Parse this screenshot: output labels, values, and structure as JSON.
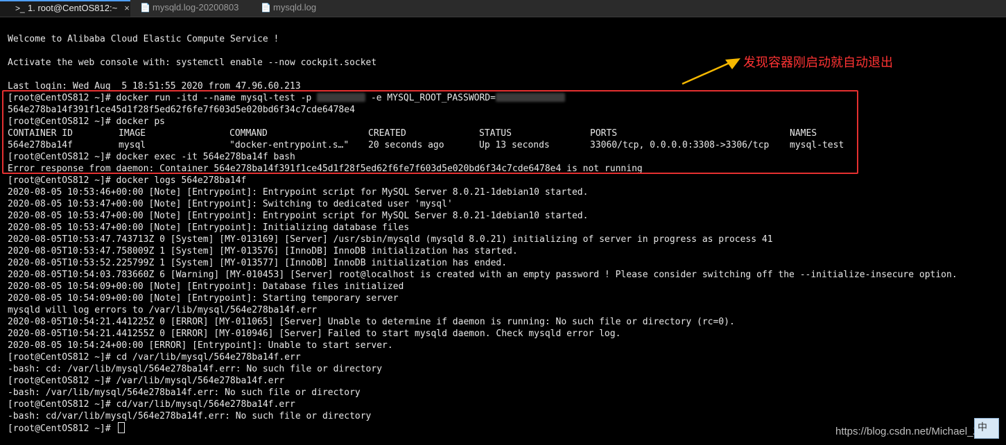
{
  "tabs": [
    {
      "icon": ">_",
      "label": "1. root@CentOS812:~",
      "close": "×"
    },
    {
      "icon": "📄",
      "label": "mysqld.log-20200803"
    },
    {
      "icon": "📄",
      "label": "mysqld.log"
    }
  ],
  "terminal": {
    "welcome": "Welcome to Alibaba Cloud Elastic Compute Service !",
    "activate": "Activate the web console with: systemctl enable --now cockpit.socket",
    "last_login": "Last login: Wed Aug  5 18:51:55 2020 from 47.96.60.213",
    "run_cmd_a": "[root@CentOS812 ~]# docker run -itd --name mysql-test -p ",
    "run_cmd_b": " -e MYSQL_ROOT_PASSWORD=",
    "container_hash": "564e278ba14f391f1ce45d1f28f5ed62f6fe7f603d5e020bd6f34c7cde6478e4",
    "ps_cmd": "[root@CentOS812 ~]# docker ps",
    "ps_headers": [
      "CONTAINER ID",
      "IMAGE",
      "COMMAND",
      "CREATED",
      "STATUS",
      "PORTS",
      "NAMES"
    ],
    "ps_row": [
      "564e278ba14f",
      "mysql",
      "\"docker-entrypoint.s…\"",
      "20 seconds ago",
      "Up 13 seconds",
      "33060/tcp, 0.0.0.0:3308->3306/tcp",
      "mysql-test"
    ],
    "exec_cmd": "[root@CentOS812 ~]# docker exec -it 564e278ba14f bash",
    "exec_error": "Error response from daemon: Container 564e278ba14f391f1ce45d1f28f5ed62f6fe7f603d5e020bd6f34c7cde6478e4 is not running",
    "rest_lines": [
      "[root@CentOS812 ~]# docker logs 564e278ba14f",
      "2020-08-05 10:53:46+00:00 [Note] [Entrypoint]: Entrypoint script for MySQL Server 8.0.21-1debian10 started.",
      "2020-08-05 10:53:47+00:00 [Note] [Entrypoint]: Switching to dedicated user 'mysql'",
      "2020-08-05 10:53:47+00:00 [Note] [Entrypoint]: Entrypoint script for MySQL Server 8.0.21-1debian10 started.",
      "2020-08-05 10:53:47+00:00 [Note] [Entrypoint]: Initializing database files",
      "2020-08-05T10:53:47.743713Z 0 [System] [MY-013169] [Server] /usr/sbin/mysqld (mysqld 8.0.21) initializing of server in progress as process 41",
      "2020-08-05T10:53:47.758009Z 1 [System] [MY-013576] [InnoDB] InnoDB initialization has started.",
      "2020-08-05T10:53:52.225799Z 1 [System] [MY-013577] [InnoDB] InnoDB initialization has ended.",
      "2020-08-05T10:54:03.783660Z 6 [Warning] [MY-010453] [Server] root@localhost is created with an empty password ! Please consider switching off the --initialize-insecure option.",
      "2020-08-05 10:54:09+00:00 [Note] [Entrypoint]: Database files initialized",
      "2020-08-05 10:54:09+00:00 [Note] [Entrypoint]: Starting temporary server",
      "mysqld will log errors to /var/lib/mysql/564e278ba14f.err",
      "2020-08-05T10:54:21.441225Z 0 [ERROR] [MY-011065] [Server] Unable to determine if daemon is running: No such file or directory (rc=0).",
      "2020-08-05T10:54:21.441255Z 0 [ERROR] [MY-010946] [Server] Failed to start mysqld daemon. Check mysqld error log.",
      "2020-08-05 10:54:24+00:00 [ERROR] [Entrypoint]: Unable to start server.",
      "[root@CentOS812 ~]# cd /var/lib/mysql/564e278ba14f.err",
      "-bash: cd: /var/lib/mysql/564e278ba14f.err: No such file or directory",
      "[root@CentOS812 ~]# /var/lib/mysql/564e278ba14f.err",
      "-bash: /var/lib/mysql/564e278ba14f.err: No such file or directory",
      "[root@CentOS812 ~]# cd/var/lib/mysql/564e278ba14f.err",
      "-bash: cd/var/lib/mysql/564e278ba14f.err: No such file or directory"
    ],
    "final_prompt": "[root@CentOS812 ~]# "
  },
  "annotation": "发现容器刚启动就自动退出",
  "watermark": "https://blog.csdn.net/Michael_Zy",
  "ime_label": "中",
  "colors": {
    "highlight_box": "#e53030",
    "annotation": "#ff3333",
    "arrow": "#f5b800",
    "active_tab_accent": "#4f9fff"
  }
}
